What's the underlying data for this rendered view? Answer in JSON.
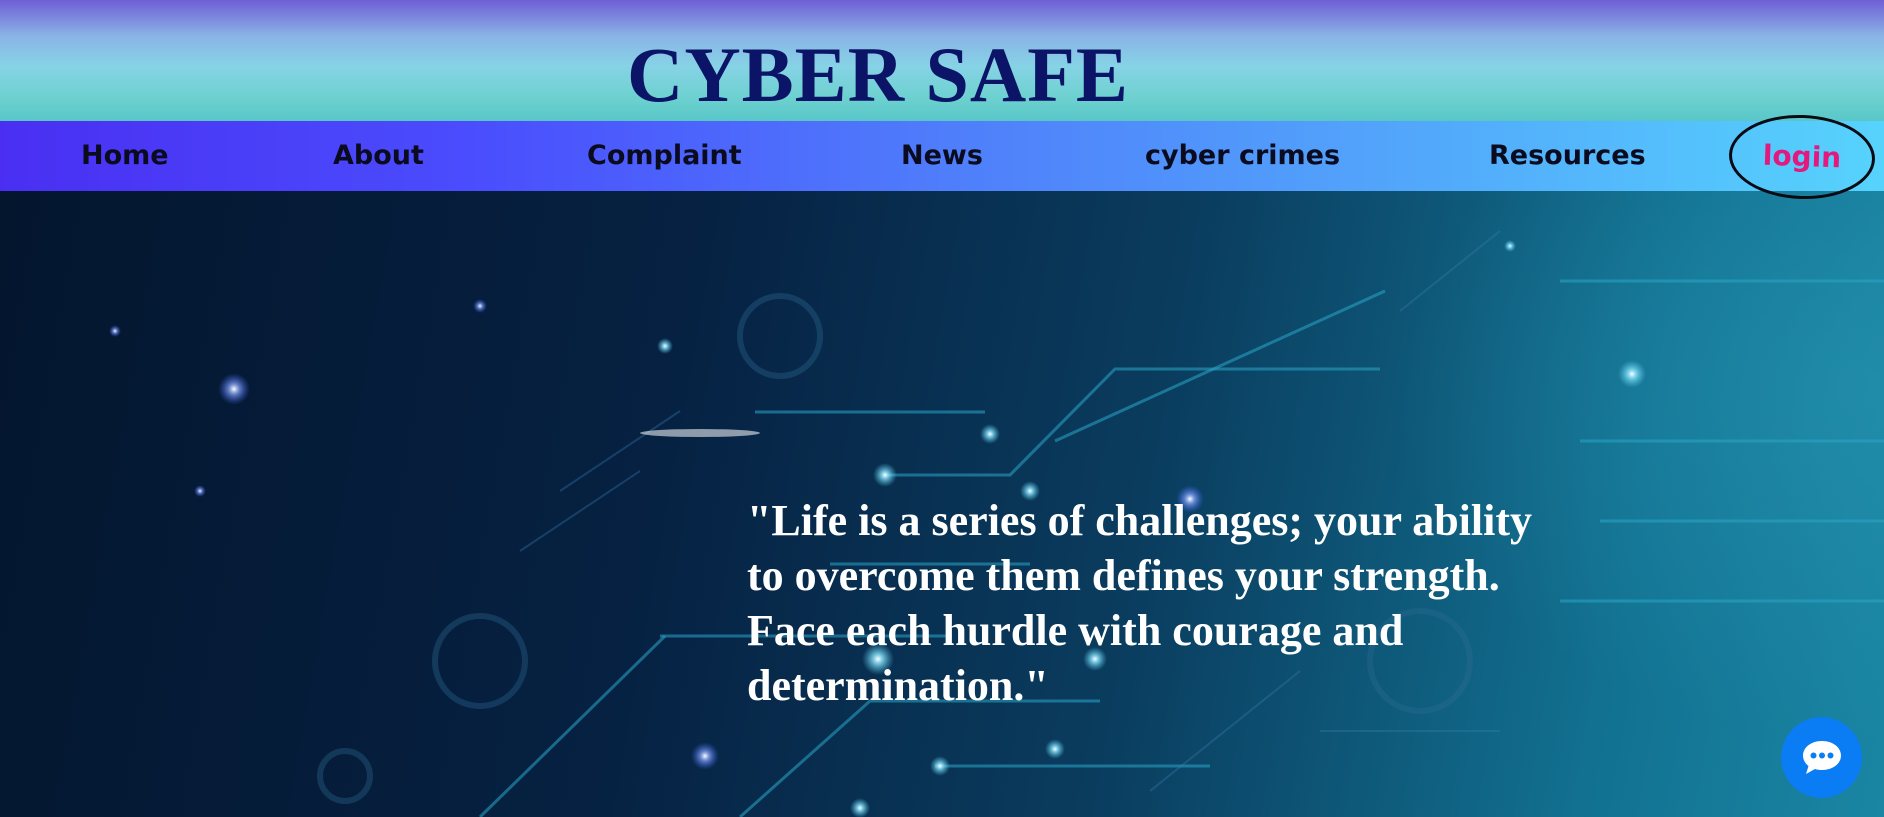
{
  "header": {
    "title": "CYBER SAFE"
  },
  "nav": {
    "items": [
      {
        "label": "Home"
      },
      {
        "label": "About"
      },
      {
        "label": "Complaint"
      },
      {
        "label": "News"
      },
      {
        "label": "cyber crimes"
      },
      {
        "label": "Resources"
      }
    ],
    "login_label": "login"
  },
  "hero": {
    "quote": "\"Life is a series of challenges; your ability to overcome them defines your strength. Face each hurdle with courage and determination.\""
  },
  "chat": {
    "icon": "chat-bubble-icon"
  },
  "colors": {
    "title": "#0b1466",
    "login": "#e3197d",
    "chat_button": "#0a7cf4"
  }
}
